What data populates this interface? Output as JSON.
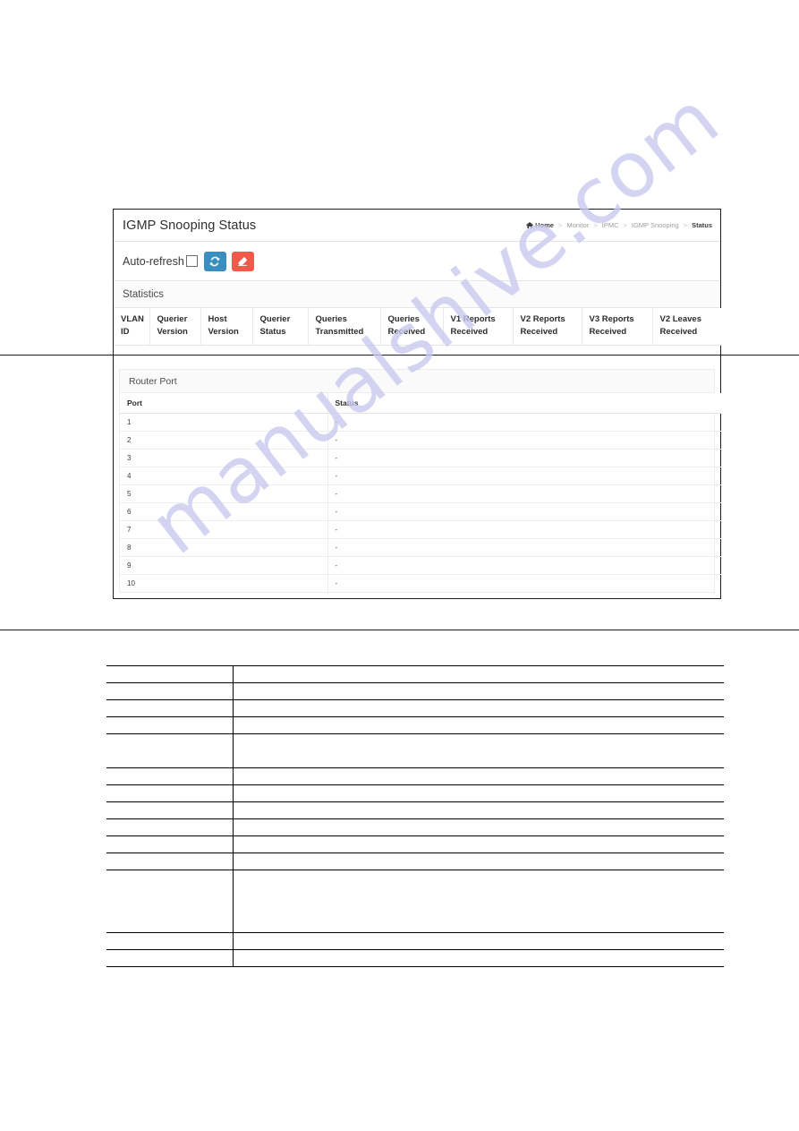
{
  "page": {
    "title": "IGMP Snooping Status"
  },
  "breadcrumb": {
    "home": "Home",
    "items": [
      "Monitor",
      "IPMC",
      "IGMP Snooping"
    ],
    "active": "Status",
    "separator": ">"
  },
  "toolbar": {
    "auto_refresh_label": "Auto-refresh",
    "auto_refresh_checked": false,
    "refresh_button": "refresh-icon",
    "clear_button": "eraser-icon",
    "refresh_color": "#3a8fbe",
    "clear_color": "#ef5a4a"
  },
  "statistics": {
    "section_title": "Statistics",
    "columns": [
      "VLAN ID",
      "Querier Version",
      "Host Version",
      "Querier Status",
      "Queries Transmitted",
      "Queries Received",
      "V1 Reports Received",
      "V2 Reports Received",
      "V3 Reports Received",
      "V2 Leaves Received"
    ],
    "columns_line1": [
      "VLAN",
      "Querier",
      "Host",
      "Querier",
      "Queries",
      "Queries",
      "V1 Reports",
      "V2 Reports",
      "V3 Reports",
      "V2 Leaves"
    ],
    "columns_line2": [
      "ID",
      "Version",
      "Version",
      "Status",
      "Transmitted",
      "Received",
      "Received",
      "Received",
      "Received",
      "Received"
    ],
    "rows": []
  },
  "router_port": {
    "section_title": "Router Port",
    "columns": [
      "Port",
      "Status"
    ],
    "rows": [
      {
        "port": "1",
        "status": "-"
      },
      {
        "port": "2",
        "status": "-"
      },
      {
        "port": "3",
        "status": "-"
      },
      {
        "port": "4",
        "status": "-"
      },
      {
        "port": "5",
        "status": "-"
      },
      {
        "port": "6",
        "status": "-"
      },
      {
        "port": "7",
        "status": "-"
      },
      {
        "port": "8",
        "status": "-"
      },
      {
        "port": "9",
        "status": "-"
      },
      {
        "port": "10",
        "status": "-"
      }
    ]
  },
  "description_table": {
    "rows": [
      {
        "label": "",
        "value": "",
        "size": "thin"
      },
      {
        "label": "",
        "value": "",
        "size": "thin"
      },
      {
        "label": "",
        "value": "",
        "size": "thin"
      },
      {
        "label": "",
        "value": "",
        "size": "thin"
      },
      {
        "label": "",
        "value": "",
        "size": "tall"
      },
      {
        "label": "",
        "value": "",
        "size": "thin"
      },
      {
        "label": "",
        "value": "",
        "size": "thin"
      },
      {
        "label": "",
        "value": "",
        "size": "thin"
      },
      {
        "label": "",
        "value": "",
        "size": "thin"
      },
      {
        "label": "",
        "value": "",
        "size": "thin"
      },
      {
        "label": "",
        "value": "",
        "size": "thin"
      },
      {
        "label": "",
        "value": "",
        "size": "xtall"
      },
      {
        "label": "",
        "value": "",
        "size": "thin"
      },
      {
        "label": "",
        "value": "",
        "size": "thin"
      }
    ]
  },
  "watermark": {
    "text": "manualshive.com",
    "color": "#c9c8ef"
  }
}
